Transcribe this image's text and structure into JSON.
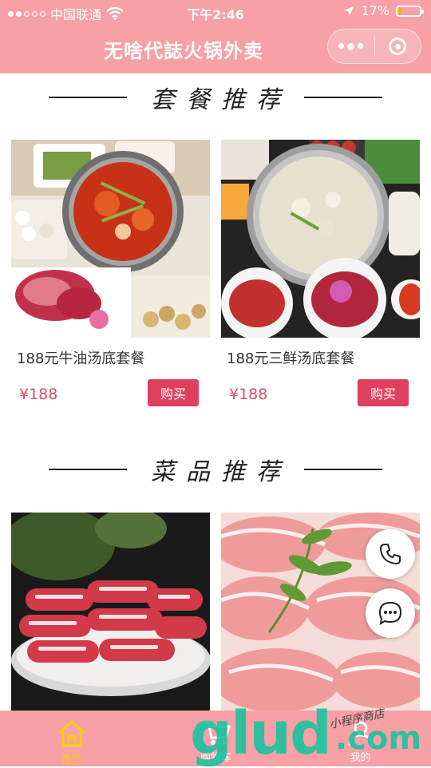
{
  "status_bar": {
    "carrier": "中国联通",
    "time": "下午2:46",
    "battery": "17%",
    "battery_level": 0.17
  },
  "nav": {
    "title": "无啥代誌火锅外卖"
  },
  "sections": {
    "set_meals_title": "套餐推荐",
    "dishes_title": "菜品推荐"
  },
  "set_meals": [
    {
      "name": "188元牛油汤底套餐",
      "price": "¥188",
      "buy_label": "购买"
    },
    {
      "name": "188元三鲜汤底套餐",
      "price": "¥188",
      "buy_label": "购买"
    }
  ],
  "tab_bar": {
    "items": [
      {
        "label": "首页",
        "icon": "home-icon",
        "active": true
      },
      {
        "label": "购物车",
        "icon": "cart-icon",
        "active": false
      },
      {
        "label": "我的",
        "icon": "user-icon",
        "active": false
      }
    ]
  },
  "watermark": {
    "text_main": "glud",
    "text_suffix": ".com",
    "script": "小程序商店"
  },
  "colors": {
    "header_pink": "#f7a0a6",
    "buy_button": "#e04060",
    "price": "#e05064",
    "tab_active": "#f2d100"
  }
}
